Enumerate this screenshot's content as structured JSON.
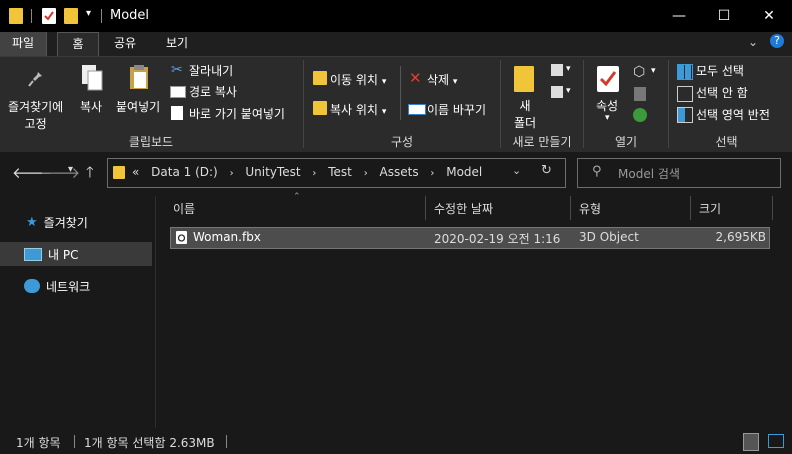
{
  "window": {
    "title": "Model",
    "minimize": "—",
    "maximize": "☐",
    "close": "✕"
  },
  "tabs": [
    {
      "label": "파일",
      "active": false
    },
    {
      "label": "홈",
      "active": true
    },
    {
      "label": "공유",
      "active": false
    },
    {
      "label": "보기",
      "active": false
    }
  ],
  "ribbon": {
    "clipboard": {
      "pin_label1": "즐겨찾기에",
      "pin_label2": "고정",
      "copy_label": "복사",
      "paste_label": "붙여넣기",
      "cut_label": "잘라내기",
      "copy_path_label": "경로 복사",
      "paste_shortcut_label": "바로 가기 붙여넣기",
      "group_label": "클립보드"
    },
    "organize": {
      "move_label": "이동 위치",
      "copy_to_label": "복사 위치",
      "delete_label": "삭제",
      "rename_label": "이름 바꾸기",
      "group_label": "구성"
    },
    "new": {
      "new_folder_label1": "새",
      "new_folder_label2": "폴더",
      "group_label": "새로 만들기"
    },
    "open": {
      "properties_label": "속성",
      "group_label": "열기"
    },
    "select": {
      "select_all_label": "모두 선택",
      "select_none_label": "선택 안 함",
      "invert_label": "선택 영역 반전",
      "group_label": "선택"
    }
  },
  "address": {
    "overflow": "«",
    "crumbs": [
      "Data 1 (D:)",
      "UnityTest",
      "Test",
      "Assets",
      "Model"
    ],
    "search_placeholder": "Model 검색"
  },
  "nav": {
    "items": [
      {
        "label": "즐겨찾기"
      },
      {
        "label": "내 PC"
      },
      {
        "label": "네트워크"
      }
    ]
  },
  "list": {
    "columns": {
      "name": "이름",
      "date": "수정한 날짜",
      "type": "유형",
      "size": "크기"
    },
    "rows": [
      {
        "name": "Woman.fbx",
        "date": "2020-02-19 오전 1:16",
        "type": "3D Object",
        "size": "2,695KB"
      }
    ]
  },
  "status": {
    "count": "1개 항목",
    "selected": "1개 항목 선택함 2.63MB"
  }
}
